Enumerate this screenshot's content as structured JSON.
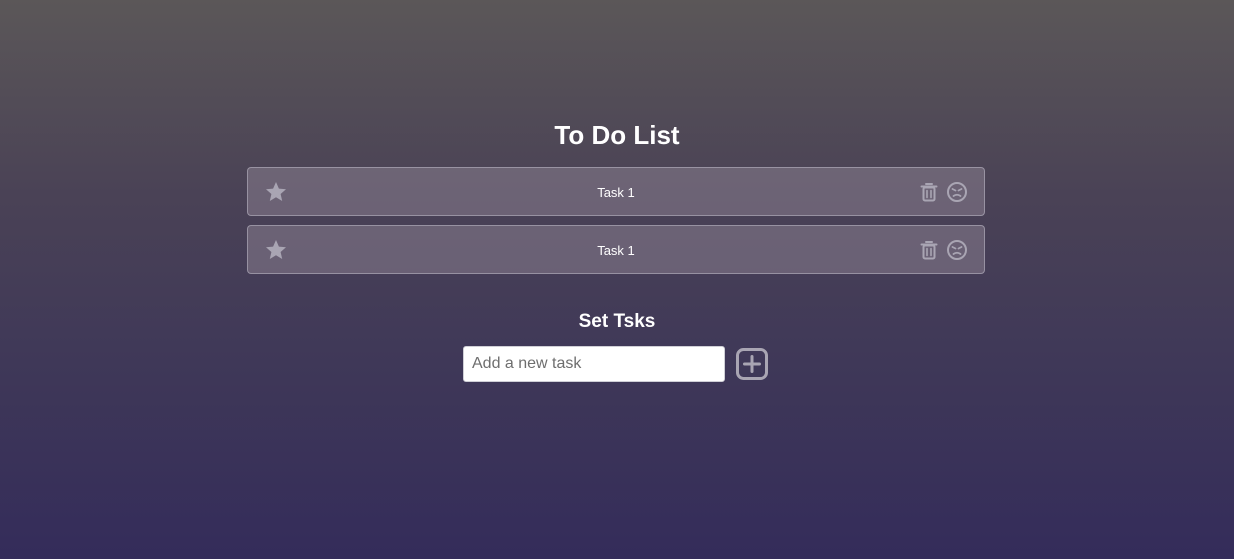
{
  "app": {
    "title": "To Do List"
  },
  "tasks": [
    {
      "label": "Task 1",
      "star_icon": "star-icon",
      "delete_icon": "trash-icon",
      "mood_icon": "angry-face-icon"
    },
    {
      "label": "Task 1",
      "star_icon": "star-icon",
      "delete_icon": "trash-icon",
      "mood_icon": "angry-face-icon"
    }
  ],
  "set_tasks": {
    "title": "Set Tsks",
    "input_value": "",
    "input_placeholder": "Add a new task",
    "add_icon": "plus-square-icon"
  },
  "colors": {
    "icon": "#a9a5b3",
    "card_border": "#bebac8",
    "input_background": "#ffffff"
  }
}
